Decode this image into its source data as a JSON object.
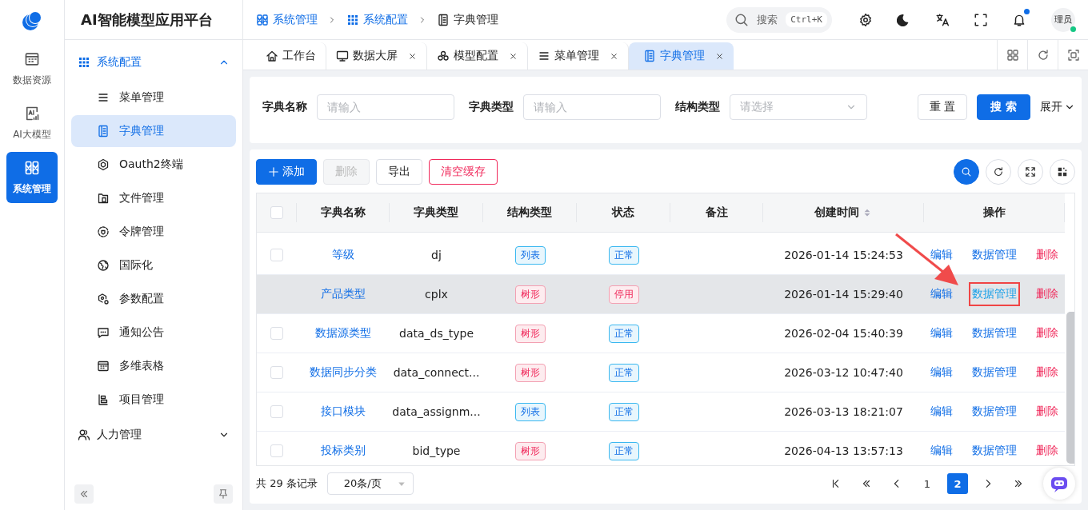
{
  "app": {
    "title": "AI智能模型应用平台"
  },
  "rail": [
    {
      "label": "数据资源",
      "selected": false
    },
    {
      "label": "AI大模型",
      "selected": false
    },
    {
      "label": "系统管理",
      "selected": true
    }
  ],
  "menu": [
    {
      "label": "系统配置",
      "expanded": true,
      "children": [
        {
          "label": "菜单管理",
          "selected": false
        },
        {
          "label": "字典管理",
          "selected": true
        },
        {
          "label": "Oauth2终端",
          "selected": false
        },
        {
          "label": "文件管理",
          "selected": false
        },
        {
          "label": "令牌管理",
          "selected": false
        },
        {
          "label": "国际化",
          "selected": false
        },
        {
          "label": "参数配置",
          "selected": false
        },
        {
          "label": "通知公告",
          "selected": false
        },
        {
          "label": "多维表格",
          "selected": false
        },
        {
          "label": "项目管理",
          "selected": false
        }
      ]
    },
    {
      "label": "人力管理",
      "expanded": false
    }
  ],
  "breadcrumb": [
    "系统管理",
    "系统配置",
    "字典管理"
  ],
  "search": {
    "placeholder": "搜索",
    "shortcut": "Ctrl+K"
  },
  "notification_dot": true,
  "user": {
    "avatar_text": "理员",
    "online": true
  },
  "tabs": [
    {
      "label": "工作台",
      "closable": false,
      "selected": false
    },
    {
      "label": "数据大屏",
      "closable": true,
      "selected": false
    },
    {
      "label": "模型配置",
      "closable": true,
      "selected": false
    },
    {
      "label": "菜单管理",
      "closable": true,
      "selected": false
    },
    {
      "label": "字典管理",
      "closable": true,
      "selected": true
    }
  ],
  "filters": [
    {
      "label": "字典名称",
      "placeholder": "请输入",
      "kind": "input"
    },
    {
      "label": "字典类型",
      "placeholder": "请输入",
      "kind": "input"
    },
    {
      "label": "结构类型",
      "placeholder": "请选择",
      "kind": "select"
    }
  ],
  "filter_actions": {
    "reset": "重 置",
    "search": "搜 索",
    "expand": "展开"
  },
  "toolbar": [
    {
      "label": "添加",
      "kind": "primary"
    },
    {
      "label": "删除",
      "kind": "disabled"
    },
    {
      "label": "导出",
      "kind": "default"
    },
    {
      "label": "清空缓存",
      "kind": "danger"
    }
  ],
  "table": {
    "select_all": {
      "checked": false
    },
    "columns": [
      "字典名称",
      "字典类型",
      "结构类型",
      "状态",
      "备注",
      "创建时间",
      "操作"
    ],
    "rows": [
      {
        "name": "等级",
        "code": "dj",
        "structure": {
          "label": "列表",
          "kind": "list"
        },
        "status": {
          "label": "正常",
          "kind": "normal"
        },
        "created": "2026-01-14 15:24:53",
        "hovered": false,
        "actions": [
          {
            "label": "编辑",
            "kind": "edit",
            "highlighted": false
          },
          {
            "label": "数据管理",
            "kind": "data",
            "highlighted": false
          },
          {
            "label": "删除",
            "kind": "delete",
            "highlighted": false
          }
        ]
      },
      {
        "name": "产品类型",
        "code": "cplx",
        "structure": {
          "label": "树形",
          "kind": "tree"
        },
        "status": {
          "label": "停用",
          "kind": "disabled"
        },
        "created": "2026-01-14 15:29:40",
        "hovered": true,
        "actions": [
          {
            "label": "编辑",
            "kind": "edit",
            "highlighted": false
          },
          {
            "label": "数据管理",
            "kind": "data",
            "highlighted": true
          },
          {
            "label": "删除",
            "kind": "delete",
            "highlighted": false
          }
        ]
      },
      {
        "name": "数据源类型",
        "code": "data_ds_type",
        "structure": {
          "label": "树形",
          "kind": "tree"
        },
        "status": {
          "label": "正常",
          "kind": "normal"
        },
        "created": "2026-02-04 15:40:39",
        "hovered": false,
        "actions": [
          {
            "label": "编辑",
            "kind": "edit",
            "highlighted": false
          },
          {
            "label": "数据管理",
            "kind": "data",
            "highlighted": false
          },
          {
            "label": "删除",
            "kind": "delete",
            "highlighted": false
          }
        ]
      },
      {
        "name": "数据同步分类",
        "code": "data_connect...",
        "structure": {
          "label": "树形",
          "kind": "tree"
        },
        "status": {
          "label": "正常",
          "kind": "normal"
        },
        "created": "2026-03-12 10:47:40",
        "hovered": false,
        "actions": [
          {
            "label": "编辑",
            "kind": "edit",
            "highlighted": false
          },
          {
            "label": "数据管理",
            "kind": "data",
            "highlighted": false
          },
          {
            "label": "删除",
            "kind": "delete",
            "highlighted": false
          }
        ]
      },
      {
        "name": "接口模块",
        "code": "data_assignm...",
        "structure": {
          "label": "列表",
          "kind": "list"
        },
        "status": {
          "label": "正常",
          "kind": "normal"
        },
        "created": "2026-03-13 18:21:07",
        "hovered": false,
        "actions": [
          {
            "label": "编辑",
            "kind": "edit",
            "highlighted": false
          },
          {
            "label": "数据管理",
            "kind": "data",
            "highlighted": false
          },
          {
            "label": "删除",
            "kind": "delete",
            "highlighted": false
          }
        ]
      },
      {
        "name": "投标类别",
        "code": "bid_type",
        "structure": {
          "label": "树形",
          "kind": "tree"
        },
        "status": {
          "label": "正常",
          "kind": "normal"
        },
        "created": "2026-04-13 13:57:13",
        "hovered": false,
        "actions": [
          {
            "label": "编辑",
            "kind": "edit",
            "highlighted": false
          },
          {
            "label": "数据管理",
            "kind": "data",
            "highlighted": false
          },
          {
            "label": "删除",
            "kind": "delete",
            "highlighted": false
          }
        ]
      }
    ]
  },
  "annotation": {
    "kind": "arrow"
  },
  "pagination": {
    "total": "共 29 条记录",
    "page_size": "20条/页",
    "pages": [
      {
        "label": "1",
        "selected": false
      },
      {
        "label": "2",
        "selected": true
      }
    ]
  }
}
